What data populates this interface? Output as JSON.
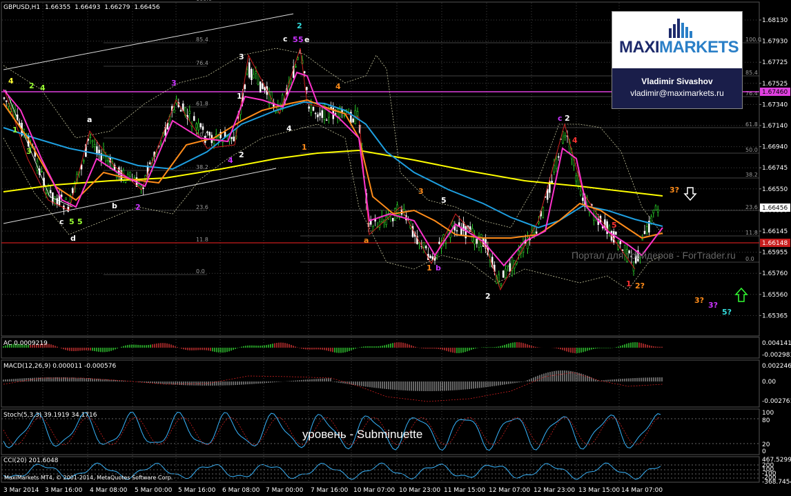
{
  "header": {
    "symbol": "GBPUSD,H1",
    "ohlc": [
      "1.66355",
      "1.66493",
      "1.66279",
      "1.66456"
    ]
  },
  "price_axis": {
    "labels": [
      "1.68130",
      "1.67930",
      "1.67725",
      "1.67525",
      "1.67340",
      "1.67140",
      "1.66940",
      "1.66745",
      "1.66550",
      "1.66350",
      "1.66145",
      "1.65955",
      "1.65760",
      "1.65560",
      "1.65365"
    ],
    "current_price": "1.66456",
    "magenta_level": "1.67460",
    "red_level": "1.66148"
  },
  "fib_levels": {
    "left": [
      "100.0",
      "85.4",
      "76.4",
      "61.8",
      "50.0",
      "38.2",
      "23.6",
      "11.8",
      "0.0"
    ],
    "right": [
      "100.0",
      "85.4",
      "76.4",
      "61.8",
      "50.0",
      "38.2",
      "23.6",
      "11.8",
      "0.0"
    ]
  },
  "time_axis": [
    "3 Mar 2014",
    "3 Mar 16:00",
    "4 Mar 08:00",
    "5 Mar 00:00",
    "5 Mar 16:00",
    "6 Mar 08:00",
    "7 Mar 00:00",
    "7 Mar 16:00",
    "10 Mar 07:00",
    "10 Mar 23:00",
    "11 Mar 15:00",
    "12 Mar 07:00",
    "12 Mar 23:00",
    "13 Mar 15:00",
    "14 Mar 07:00"
  ],
  "wave_labels": [
    "4",
    "2",
    "4",
    "1",
    "3",
    "a",
    "b",
    "c",
    "5",
    "5",
    "d",
    "2",
    "3",
    "4",
    "3",
    "1",
    "2",
    "4",
    "c",
    "5",
    "5",
    "e",
    "2",
    "1",
    "4",
    "3",
    "a",
    "5",
    "1",
    "b",
    "2",
    "c",
    "2",
    "4",
    "5",
    "1",
    "2?",
    "3?",
    "3?",
    "3?",
    "5?"
  ],
  "ac_panel": {
    "label": "AC 0.0009219",
    "scale": [
      "0.004141",
      "-0.002983"
    ]
  },
  "macd_panel": {
    "label": "MACD(12,26,9) 0.000011 -0.000576",
    "scale": [
      "0.002246",
      "0.00",
      "-0.002761"
    ]
  },
  "stoch_panel": {
    "label": "Stoch(5,3,3) 39.1919 34.1716",
    "scale": [
      "100",
      "80",
      "20",
      "0"
    ]
  },
  "cci_panel": {
    "label": "CCI(20) 201.6048",
    "scale": [
      "467.5299",
      "200",
      "100",
      "-100",
      "-200",
      "-368.7454"
    ]
  },
  "logo": {
    "brand_part1": "MAXI",
    "brand_part2": "MARKETS",
    "analyst": "Vladimir Sivashov",
    "email": "vladimir@maximarkets.ru"
  },
  "watermark": "Портал для трейдеров - ForTrader.ru",
  "caption": "уровень - Subminuette",
  "copyright": "MaxiMarkets MT4, © 2001-2014, MetaQuotes Software Corp.",
  "colors": {
    "ma_yellow": "#ffff00",
    "ma_blue": "#1e9fe0",
    "ma_orange": "#ff8c1a",
    "ma_magenta": "#ff33cc",
    "magenta_level": "#e040e0",
    "red_level": "#c81e1e"
  },
  "icons": [
    "arrow-down-icon",
    "arrow-up-icon"
  ]
}
